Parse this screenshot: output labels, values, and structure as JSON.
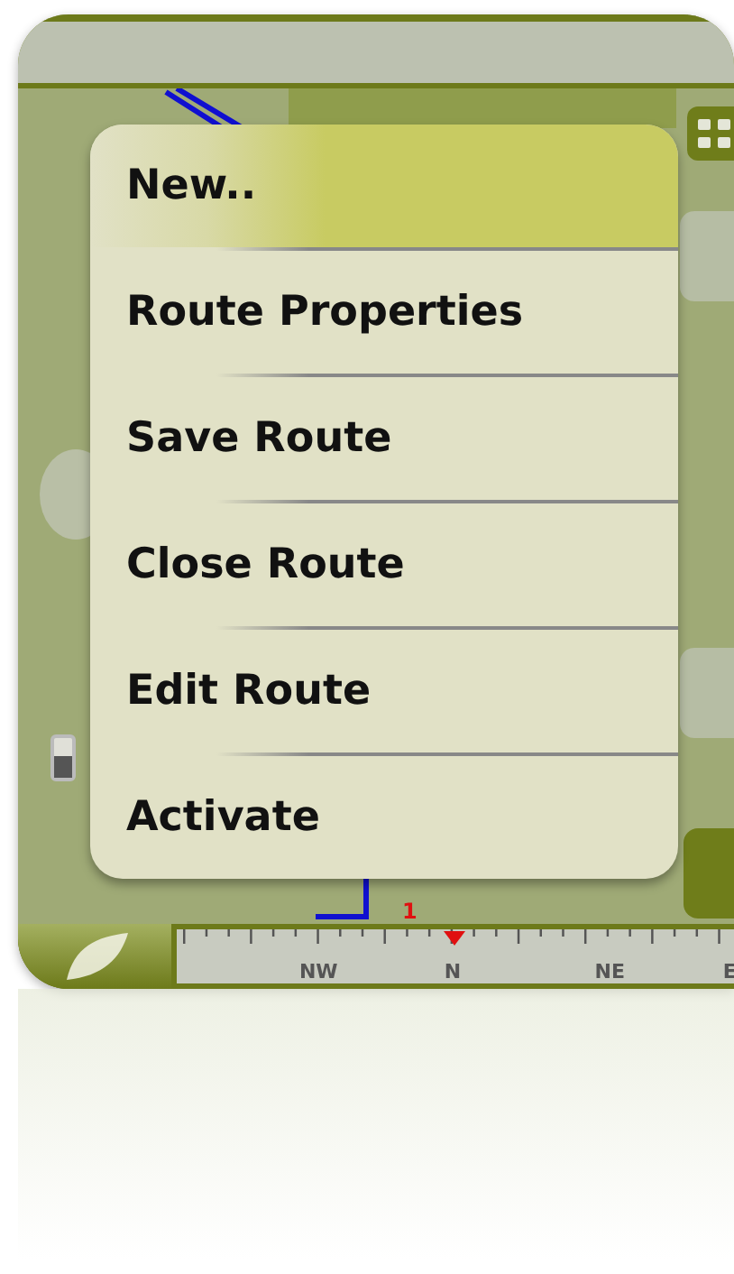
{
  "menu": {
    "items": [
      {
        "label": "New..",
        "selected": true
      },
      {
        "label": "Route Properties",
        "selected": false
      },
      {
        "label": "Save Route",
        "selected": false
      },
      {
        "label": "Close Route",
        "selected": false
      },
      {
        "label": "Edit Route",
        "selected": false
      },
      {
        "label": "Activate",
        "selected": false
      }
    ]
  },
  "map": {
    "waypoint_label": "1"
  },
  "compass": {
    "labels": [
      "NW",
      "N",
      "NE",
      "E"
    ]
  }
}
